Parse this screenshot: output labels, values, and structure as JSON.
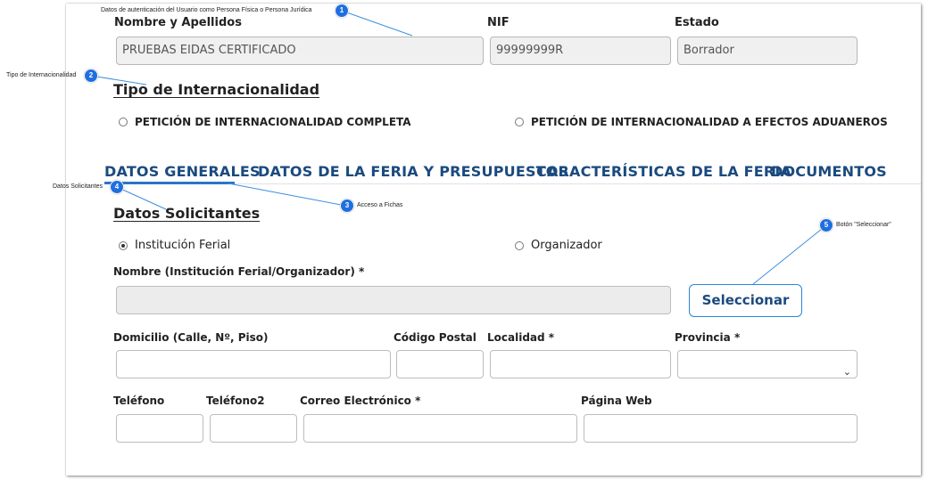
{
  "user": {
    "name_label": "Nombre y Apellidos",
    "name_value": "PRUEBAS EIDAS CERTIFICADO",
    "nif_label": "NIF",
    "nif_value": "99999999R",
    "estado_label": "Estado",
    "estado_value": "Borrador"
  },
  "internacionalidad": {
    "title": "Tipo de Internacionalidad",
    "option_completa": "PETICIÓN DE INTERNACIONALIDAD COMPLETA",
    "option_aduaneros": "PETICIÓN DE INTERNACIONALIDAD A EFECTOS ADUANEROS"
  },
  "tabs": [
    {
      "label": "DATOS GENERALES",
      "active": true
    },
    {
      "label": "DATOS DE LA FERIA Y PRESUPUESTOS",
      "active": false
    },
    {
      "label": "CARACTERÍSTICAS DE LA FERIA",
      "active": false
    },
    {
      "label": "DOCUMENTOS",
      "active": false
    }
  ],
  "solicitantes": {
    "title": "Datos Solicitantes",
    "option_institucion": "Institución Ferial",
    "option_organizador": "Organizador",
    "selected": "Institución Ferial",
    "nombre_label": "Nombre (Institución Ferial/Organizador) *",
    "nombre_value": "",
    "select_button": "Seleccionar",
    "domicilio_label": "Domicilio (Calle, Nº, Piso)",
    "cp_label": "Código Postal",
    "localidad_label": "Localidad *",
    "provincia_label": "Provincia *",
    "telefono_label": "Teléfono",
    "telefono2_label": "Teléfono2",
    "correo_label": "Correo Electrónico *",
    "web_label": "Página Web"
  },
  "callouts": [
    {
      "num": "1",
      "text": "Datos de autenticación del Usuario como Persona Física o Persona Jurídica"
    },
    {
      "num": "2",
      "text": "Tipo de Internacionalidad"
    },
    {
      "num": "3",
      "text": "Acceso a Fichas"
    },
    {
      "num": "4",
      "text": "Datos Solicitantes"
    },
    {
      "num": "5",
      "text": "Botón \"Seleccionar\""
    }
  ],
  "colors": {
    "accent": "#2a76c6",
    "tab_text": "#1b4a7e",
    "badge": "#1f6fe0"
  }
}
